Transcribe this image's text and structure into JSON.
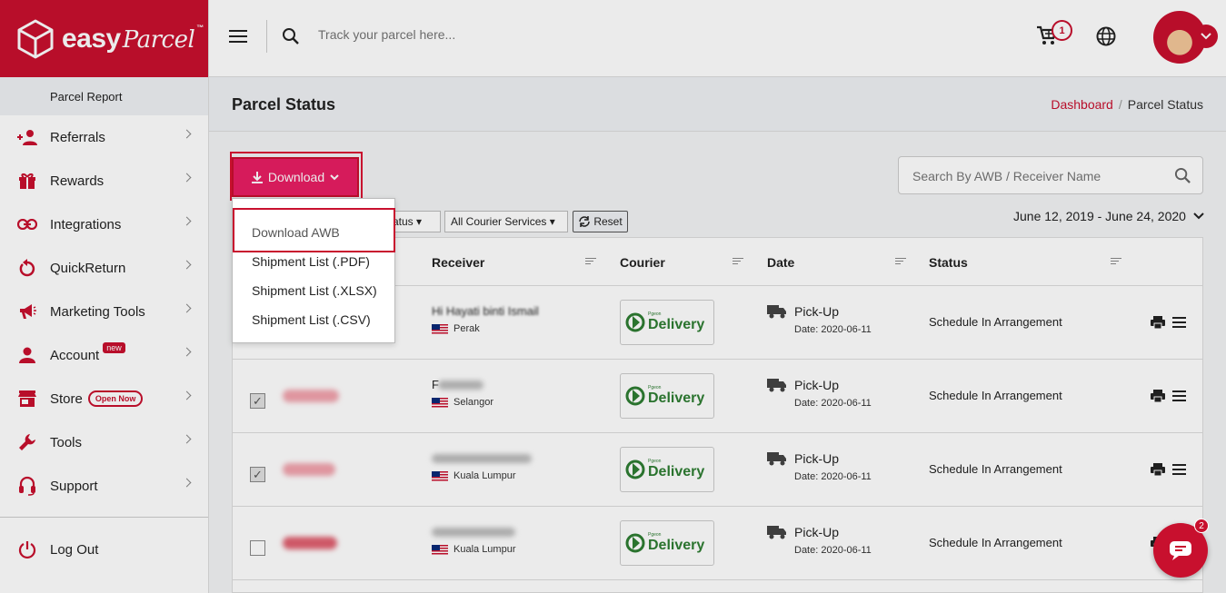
{
  "brand": {
    "name": "easy",
    "script": "Parcel",
    "tm": "™",
    "color": "#c8102e"
  },
  "sidebar": {
    "current_sub": "Parcel Report",
    "items": [
      {
        "label": "Referrals",
        "icon": "referrals-icon"
      },
      {
        "label": "Rewards",
        "icon": "gift-icon"
      },
      {
        "label": "Integrations",
        "icon": "link-icon"
      },
      {
        "label": "QuickReturn",
        "icon": "return-icon"
      },
      {
        "label": "Marketing Tools",
        "icon": "megaphone-icon"
      },
      {
        "label": "Account",
        "icon": "user-icon",
        "badge": "new"
      },
      {
        "label": "Store",
        "icon": "store-icon",
        "badge": "Open Now"
      },
      {
        "label": "Tools",
        "icon": "wrench-icon"
      },
      {
        "label": "Support",
        "icon": "headset-icon"
      }
    ],
    "logout": "Log Out"
  },
  "topbar": {
    "search_placeholder": "Track your parcel here...",
    "cart_count": "1"
  },
  "page": {
    "title": "Parcel Status",
    "breadcrumb": {
      "home": "Dashboard",
      "sep": "/",
      "current": "Parcel Status"
    }
  },
  "toolbar": {
    "download_label": "Download",
    "search_placeholder": "Search By AWB / Receiver Name",
    "filter_status": "atus",
    "filter_courier": "All Courier Services",
    "reset_label": "Reset",
    "date_range": "June 12, 2019 - June 24, 2020"
  },
  "dropdown": {
    "items": [
      "Download AWB",
      "Shipment List (.PDF)",
      "Shipment List (.XLSX)",
      "Shipment List (.CSV)"
    ]
  },
  "table": {
    "headers": {
      "receiver": "Receiver",
      "courier": "Courier",
      "date": "Date",
      "status": "Status"
    },
    "rows": [
      {
        "checked": false,
        "receiver_name": "Hi Hayati binti Ismail",
        "receiver_loc": "Perak",
        "courier_small": "Pgeon",
        "courier": "Delivery",
        "date_title": "Pick-Up",
        "date_sub": "Date: 2020-06-11",
        "status": "Schedule In Arrangement"
      },
      {
        "checked": true,
        "receiver_name": "F",
        "receiver_loc": "Selangor",
        "courier_small": "Pgeon",
        "courier": "Delivery",
        "date_title": "Pick-Up",
        "date_sub": "Date: 2020-06-11",
        "status": "Schedule In Arrangement"
      },
      {
        "checked": true,
        "receiver_name": "",
        "receiver_loc": "Kuala Lumpur",
        "courier_small": "Pgeon",
        "courier": "Delivery",
        "date_title": "Pick-Up",
        "date_sub": "Date: 2020-06-11",
        "status": "Schedule In Arrangement"
      },
      {
        "checked": false,
        "receiver_name": "",
        "receiver_loc": "Kuala Lumpur",
        "courier_small": "Pgeon",
        "courier": "Delivery",
        "date_title": "Pick-Up",
        "date_sub": "Date: 2020-06-11",
        "status": "Schedule In Arrangement"
      }
    ]
  },
  "chat": {
    "badge": "2"
  }
}
